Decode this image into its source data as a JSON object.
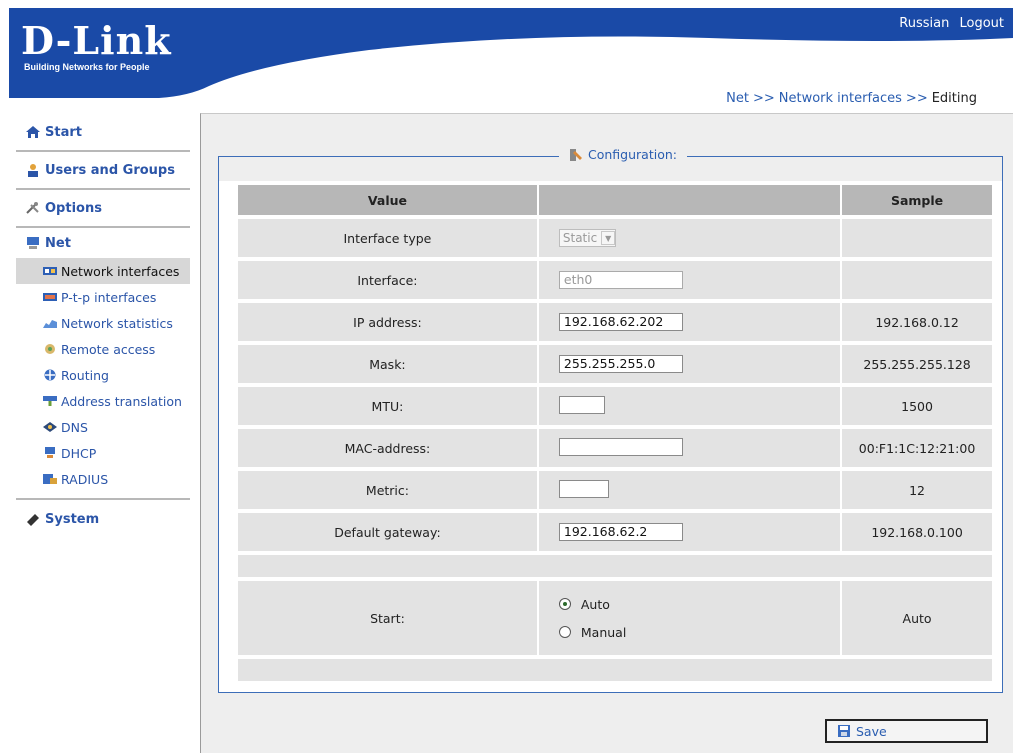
{
  "header": {
    "logo_text": "D-Link",
    "logo_tagline": "Building Networks for People",
    "lang_link": "Russian",
    "logout_link": "Logout"
  },
  "breadcrumb": {
    "items": [
      "Net",
      "Network interfaces"
    ],
    "separator": ">>",
    "current": "Editing"
  },
  "sidebar": {
    "start": "Start",
    "users": "Users and Groups",
    "options": "Options",
    "net": "Net",
    "net_items": [
      {
        "label": "Network interfaces",
        "icon": "network-card-icon",
        "active": true
      },
      {
        "label": "P-t-p interfaces",
        "icon": "ptp-icon",
        "active": false
      },
      {
        "label": "Network statistics",
        "icon": "stats-icon",
        "active": false
      },
      {
        "label": "Remote access",
        "icon": "remote-access-icon",
        "active": false
      },
      {
        "label": "Routing",
        "icon": "routing-icon",
        "active": false
      },
      {
        "label": "Address translation",
        "icon": "nat-icon",
        "active": false
      },
      {
        "label": "DNS",
        "icon": "dns-icon",
        "active": false
      },
      {
        "label": "DHCP",
        "icon": "dhcp-icon",
        "active": false
      },
      {
        "label": "RADIUS",
        "icon": "radius-icon",
        "active": false
      }
    ],
    "system": "System"
  },
  "config": {
    "legend": "Configuration:",
    "headers": {
      "value": "Value",
      "input": "",
      "sample": "Sample"
    },
    "rows": {
      "interface_type": {
        "label": "Interface type",
        "value": "Static",
        "sample": ""
      },
      "interface": {
        "label": "Interface:",
        "value": "eth0",
        "sample": ""
      },
      "ip": {
        "label": "IP address:",
        "value": "192.168.62.202",
        "sample": "192.168.0.12"
      },
      "mask": {
        "label": "Mask:",
        "value": "255.255.255.0",
        "sample": "255.255.255.128"
      },
      "mtu": {
        "label": "MTU:",
        "value": "",
        "sample": "1500"
      },
      "mac": {
        "label": "MAC-address:",
        "value": "",
        "sample": "00:F1:1C:12:21:00"
      },
      "metric": {
        "label": "Metric:",
        "value": "",
        "sample": "12"
      },
      "gateway": {
        "label": "Default gateway:",
        "value": "192.168.62.2",
        "sample": "192.168.0.100"
      }
    },
    "start": {
      "label": "Start:",
      "options": [
        "Auto",
        "Manual"
      ],
      "selected": "Auto",
      "sample": "Auto"
    }
  },
  "save_label": "Save",
  "colors": {
    "brand_blue": "#2b55a8",
    "link_blue": "#2a5db0",
    "active_bg": "#d7d7d7"
  }
}
